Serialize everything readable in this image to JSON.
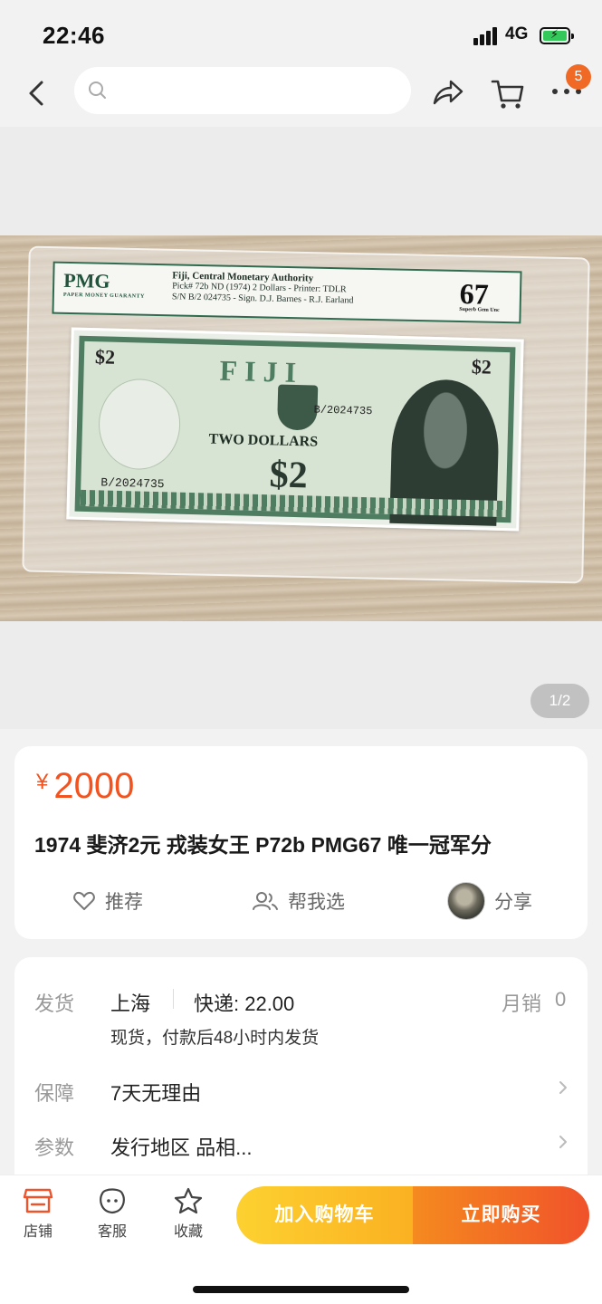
{
  "status_bar": {
    "time": "22:46",
    "network": "4G"
  },
  "nav": {
    "search_placeholder": "",
    "more_badge": "5"
  },
  "gallery": {
    "pager": "1/2",
    "photo": {
      "label_logo": "PMG",
      "label_logo_sub": "PAPER MONEY GUARANTY",
      "label_line1": "Fiji, Central Monetary Authority",
      "label_line2": "Pick# 72b  ND (1974)  2 Dollars - Printer: TDLR",
      "label_line3": "S/N B/2 024735 - Sign. D.J. Barnes - R.J. Earland",
      "label_grade": "67",
      "label_grade_sub": "Superb Gem Unc",
      "note_denom": "$2",
      "note_country": "FIJI",
      "note_words": "TWO DOLLARS",
      "note_serial": "B/2024735"
    }
  },
  "product": {
    "currency": "¥",
    "price": "2000",
    "title": "1974 斐济2元 戎装女王 P72b PMG67 唯一冠军分",
    "actions": {
      "recommend": "推荐",
      "help_choose": "帮我选",
      "share": "分享"
    }
  },
  "details": {
    "shipping_label": "发货",
    "shipping_from": "上海",
    "express": "快递: 22.00",
    "monthly_sales_label": "月销",
    "monthly_sales": "0",
    "shipping_note": "现货，付款后48小时内发货",
    "guarantee_label": "保障",
    "guarantee_value": "7天无理由",
    "params_label": "参数",
    "params_value": "发行地区 品相..."
  },
  "bottom_bar": {
    "shop": "店铺",
    "service": "客服",
    "favorite": "收藏",
    "add_to_cart": "加入购物车",
    "buy_now": "立即购买"
  },
  "colors": {
    "accent": "#f2531f",
    "cart_button": "#fbb122",
    "buy_button": "#f0522a",
    "badge": "#f06a25"
  }
}
